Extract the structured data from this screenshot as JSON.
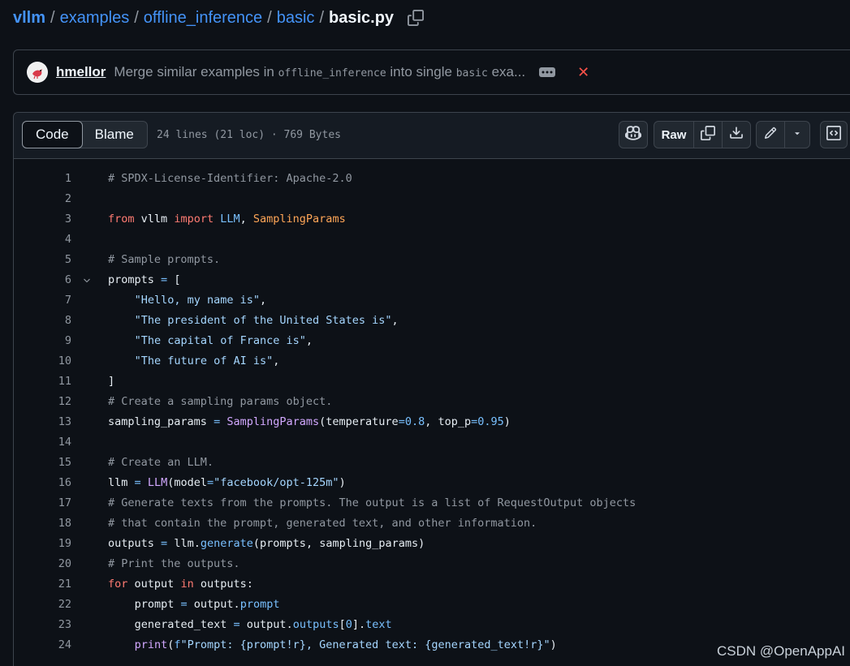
{
  "breadcrumb": {
    "repo": "vllm",
    "path1": "examples",
    "path2": "offline_inference",
    "path3": "basic",
    "file": "basic.py",
    "sep": "/"
  },
  "commit": {
    "author": "hmellor",
    "msg_start": "Merge similar examples in",
    "msg_code1": "offline_inference",
    "msg_mid": "into single",
    "msg_code2": "basic",
    "msg_end": "exa..."
  },
  "file_header": {
    "tab_code": "Code",
    "tab_blame": "Blame",
    "info": "24 lines (21 loc) · 769 Bytes",
    "raw_label": "Raw"
  },
  "code_lines": [
    "# SPDX-License-Identifier: Apache-2.0",
    "",
    "from vllm import LLM, SamplingParams",
    "",
    "# Sample prompts.",
    "prompts = [",
    "    \"Hello, my name is\",",
    "    \"The president of the United States is\",",
    "    \"The capital of France is\",",
    "    \"The future of AI is\",",
    "]",
    "# Create a sampling params object.",
    "sampling_params = SamplingParams(temperature=0.8, top_p=0.95)",
    "",
    "# Create an LLM.",
    "llm = LLM(model=\"facebook/opt-125m\")",
    "# Generate texts from the prompts. The output is a list of RequestOutput objects",
    "# that contain the prompt, generated text, and other information.",
    "outputs = llm.generate(prompts, sampling_params)",
    "# Print the outputs.",
    "for output in outputs:",
    "    prompt = output.prompt",
    "    generated_text = output.outputs[0].text",
    "    print(f\"Prompt: {prompt!r}, Generated text: {generated_text!r}\")"
  ],
  "line_numbers": [
    "1",
    "2",
    "3",
    "4",
    "5",
    "6",
    "7",
    "8",
    "9",
    "10",
    "11",
    "12",
    "13",
    "14",
    "15",
    "16",
    "17",
    "18",
    "19",
    "20",
    "21",
    "22",
    "23",
    "24"
  ],
  "watermark": "CSDN @OpenAppAI",
  "colors": {
    "background": "#0d1117",
    "link": "#4493f8",
    "comment": "#9198a1",
    "keyword": "#ff7b72",
    "builtin": "#79c0ff",
    "class": "#ffa657",
    "string": "#a5d6ff",
    "function": "#d2a8ff"
  }
}
